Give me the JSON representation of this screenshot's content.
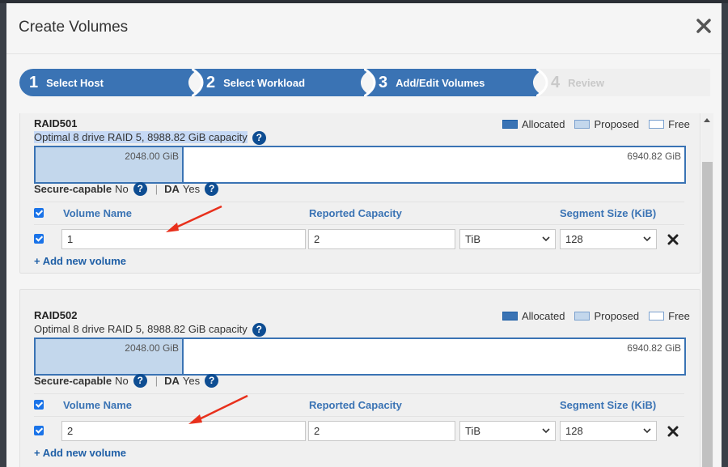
{
  "dialog": {
    "title": "Create Volumes"
  },
  "steps": [
    {
      "num": "1",
      "label": "Select Host"
    },
    {
      "num": "2",
      "label": "Select Workload"
    },
    {
      "num": "3",
      "label": "Add/Edit Volumes"
    },
    {
      "num": "4",
      "label": "Review"
    }
  ],
  "legend": {
    "allocated": "Allocated",
    "proposed": "Proposed",
    "free": "Free"
  },
  "raids": [
    {
      "name": "RAID501",
      "description": "Optimal 8 drive RAID 5, 8988.82 GiB capacity",
      "used_label": "2048.00 GiB",
      "free_label": "6940.82 GiB",
      "used_fraction": 0.228,
      "secure_label": "Secure-capable",
      "secure_value": "No",
      "da_label": "DA",
      "da_value": "Yes",
      "col_volume_name": "Volume Name",
      "col_reported_capacity": "Reported Capacity",
      "col_segment_size": "Segment Size (KiB)",
      "volume": {
        "name": "1",
        "capacity": "2",
        "unit": "TiB",
        "segment": "128"
      },
      "add_label": "+ Add new volume"
    },
    {
      "name": "RAID502",
      "description": "Optimal 8 drive RAID 5, 8988.82 GiB capacity",
      "used_label": "2048.00 GiB",
      "free_label": "6940.82 GiB",
      "used_fraction": 0.228,
      "secure_label": "Secure-capable",
      "secure_value": "No",
      "da_label": "DA",
      "da_value": "Yes",
      "col_volume_name": "Volume Name",
      "col_reported_capacity": "Reported Capacity",
      "col_segment_size": "Segment Size (KiB)",
      "volume": {
        "name": "2",
        "capacity": "2",
        "unit": "TiB",
        "segment": "128"
      },
      "add_label": "+ Add new volume"
    }
  ],
  "colors": {
    "step_active": "#3a73b4",
    "step_disabled": "#efefef",
    "accent": "#1f5fa6",
    "annotation_arrow": "#e8301c"
  },
  "icons": [
    "close-icon",
    "help-icon",
    "checkbox-icon",
    "chevron-down-icon",
    "delete-icon",
    "annotation-arrow"
  ]
}
